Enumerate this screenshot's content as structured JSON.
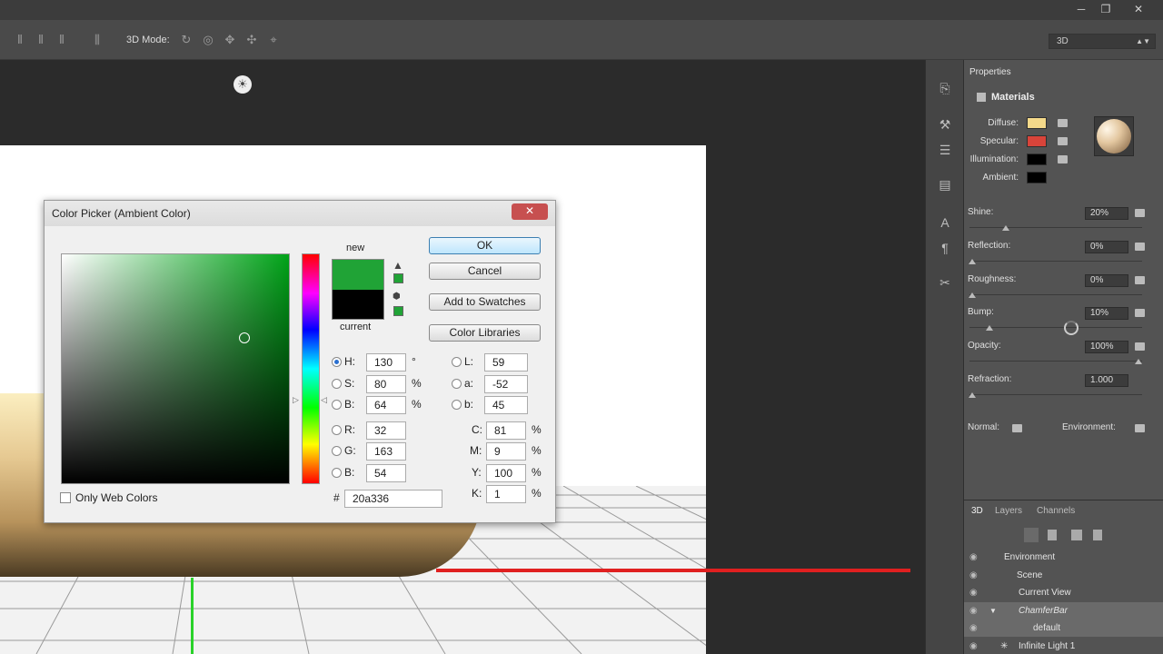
{
  "app": {
    "window_controls": [
      "─",
      "❐",
      "✕"
    ]
  },
  "options_bar": {
    "mode_label": "3D Mode:",
    "workspace": "3D"
  },
  "color_picker": {
    "title": "Color Picker (Ambient Color)",
    "new_label": "new",
    "current_label": "current",
    "new_color": "#20a336",
    "current_color": "#000000",
    "buttons": {
      "ok": "OK",
      "cancel": "Cancel",
      "add_to_swatches": "Add to Swatches",
      "color_libraries": "Color Libraries"
    },
    "fields": {
      "H": {
        "label": "H:",
        "value": "130",
        "unit": "°"
      },
      "S": {
        "label": "S:",
        "value": "80",
        "unit": "%"
      },
      "B": {
        "label": "B:",
        "value": "64",
        "unit": "%"
      },
      "R": {
        "label": "R:",
        "value": "32"
      },
      "G": {
        "label": "G:",
        "value": "163"
      },
      "Bb": {
        "label": "B:",
        "value": "54"
      },
      "L": {
        "label": "L:",
        "value": "59"
      },
      "a": {
        "label": "a:",
        "value": "-52"
      },
      "b": {
        "label": "b:",
        "value": "45"
      },
      "C": {
        "label": "C:",
        "value": "81",
        "unit": "%"
      },
      "M": {
        "label": "M:",
        "value": "9",
        "unit": "%"
      },
      "Y": {
        "label": "Y:",
        "value": "100",
        "unit": "%"
      },
      "K": {
        "label": "K:",
        "value": "1",
        "unit": "%"
      }
    },
    "hex_label": "#",
    "hex_value": "20a336",
    "only_web_colors": "Only Web Colors"
  },
  "properties": {
    "tab": "Properties",
    "section": "Materials",
    "swatches": [
      {
        "label": "Diffuse:",
        "color": "#f4d98a"
      },
      {
        "label": "Specular:",
        "color": "#d8443a"
      },
      {
        "label": "Illumination:",
        "color": "#000000"
      },
      {
        "label": "Ambient:",
        "color": "#000000"
      }
    ],
    "sliders": [
      {
        "label": "Shine:",
        "value": "20%"
      },
      {
        "label": "Reflection:",
        "value": "0%"
      },
      {
        "label": "Roughness:",
        "value": "0%"
      },
      {
        "label": "Bump:",
        "value": "10%"
      },
      {
        "label": "Opacity:",
        "value": "100%"
      },
      {
        "label": "Refraction:",
        "value": "1.000"
      }
    ],
    "normal_label": "Normal:",
    "environment_label": "Environment:"
  },
  "layers_panel": {
    "tabs": [
      "3D",
      "Layers",
      "Channels"
    ],
    "rows": [
      "Environment",
      "Scene",
      "Current View",
      "ChamferBar",
      "default",
      "Infinite Light 1"
    ]
  }
}
